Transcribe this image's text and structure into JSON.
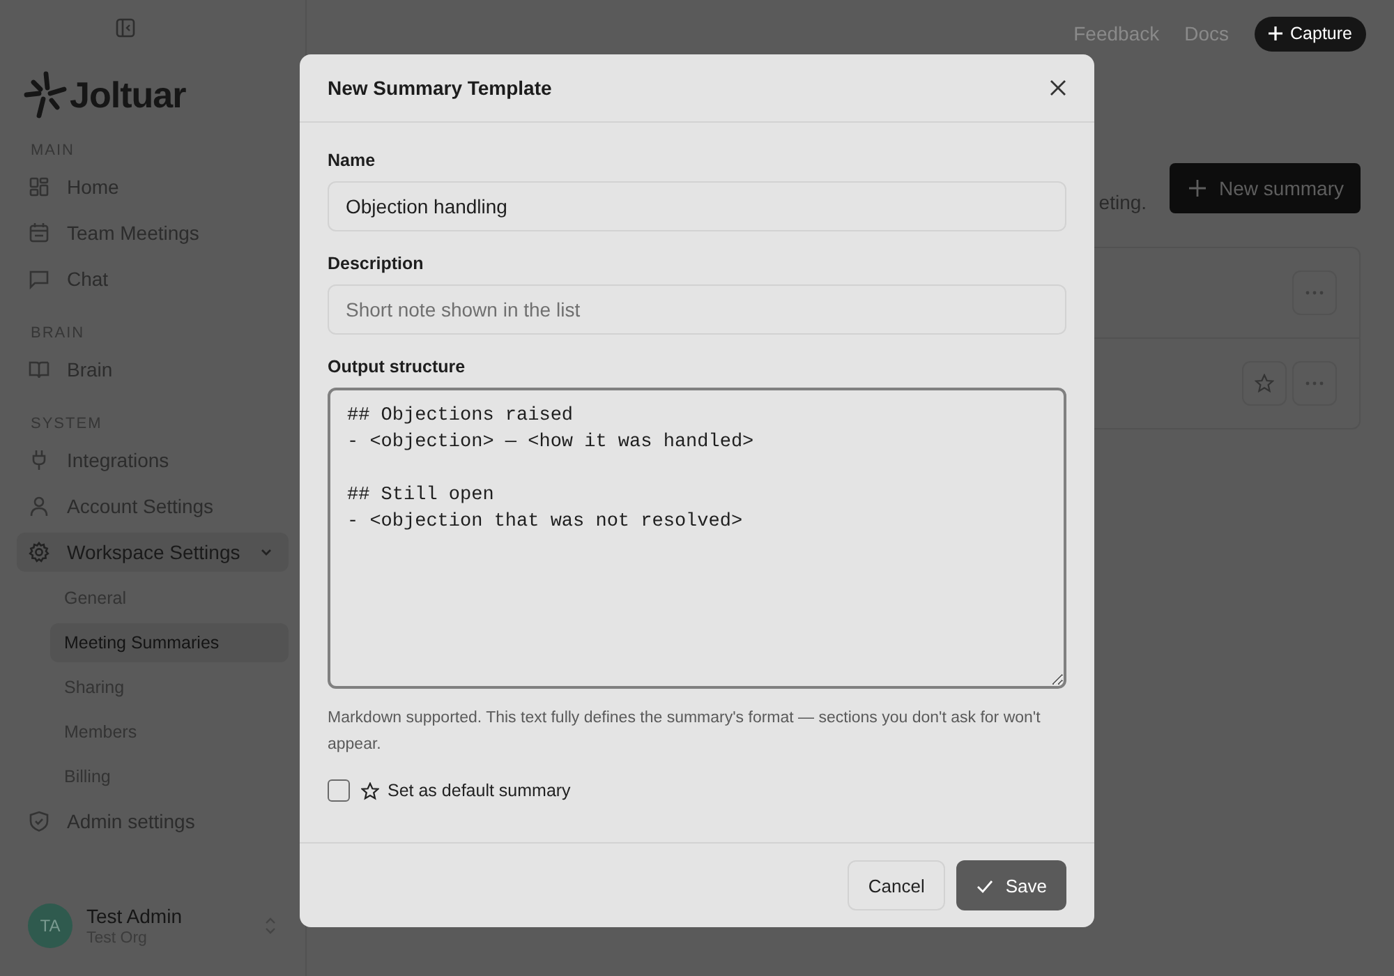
{
  "sidebar": {
    "brand": "Joltuar",
    "sections": [
      {
        "label": "MAIN",
        "items": [
          {
            "label": "Home",
            "selected": false
          },
          {
            "label": "Team Meetings",
            "selected": false
          },
          {
            "label": "Chat",
            "selected": false
          }
        ]
      },
      {
        "label": "BRAIN",
        "items": [
          {
            "label": "Brain",
            "selected": false
          }
        ]
      },
      {
        "label": "SYSTEM",
        "items": [
          {
            "label": "Integrations",
            "selected": false
          },
          {
            "label": "Account Settings",
            "selected": false
          },
          {
            "label": "Workspace Settings",
            "selected": true,
            "expanded": true,
            "children": [
              {
                "label": "General",
                "selected": false
              },
              {
                "label": "Meeting Summaries",
                "selected": true
              },
              {
                "label": "Sharing",
                "selected": false
              },
              {
                "label": "Members",
                "selected": false
              },
              {
                "label": "Billing",
                "selected": false
              }
            ]
          },
          {
            "label": "Admin settings",
            "selected": false
          }
        ]
      }
    ],
    "user": {
      "initials": "TA",
      "name": "Test Admin",
      "org": "Test Org"
    }
  },
  "topbar": {
    "links": [
      "Feedback",
      "Docs"
    ],
    "capture_button": "Capture"
  },
  "page": {
    "description_fragment": "eting.",
    "new_button": "New summary",
    "templates": [
      {
        "is_default": true
      },
      {
        "is_default": false
      }
    ]
  },
  "dialog": {
    "title": "New Summary Template",
    "fields": [
      {
        "label": "Name",
        "value": "Objection handling"
      },
      {
        "label": "Description",
        "placeholder": "Short note shown in the list"
      }
    ],
    "output": {
      "label": "Output structure",
      "value": "## Objections raised\n- <objection> — <how it was handled>\n\n## Still open\n- <objection that was not resolved>",
      "help": "Markdown supported. This text fully defines the summary's format — sections you don't ask for won't appear."
    },
    "default_checkbox": {
      "label": "Set as default summary",
      "checked": false
    },
    "buttons": {
      "cancel": "Cancel",
      "save": "Save"
    }
  }
}
